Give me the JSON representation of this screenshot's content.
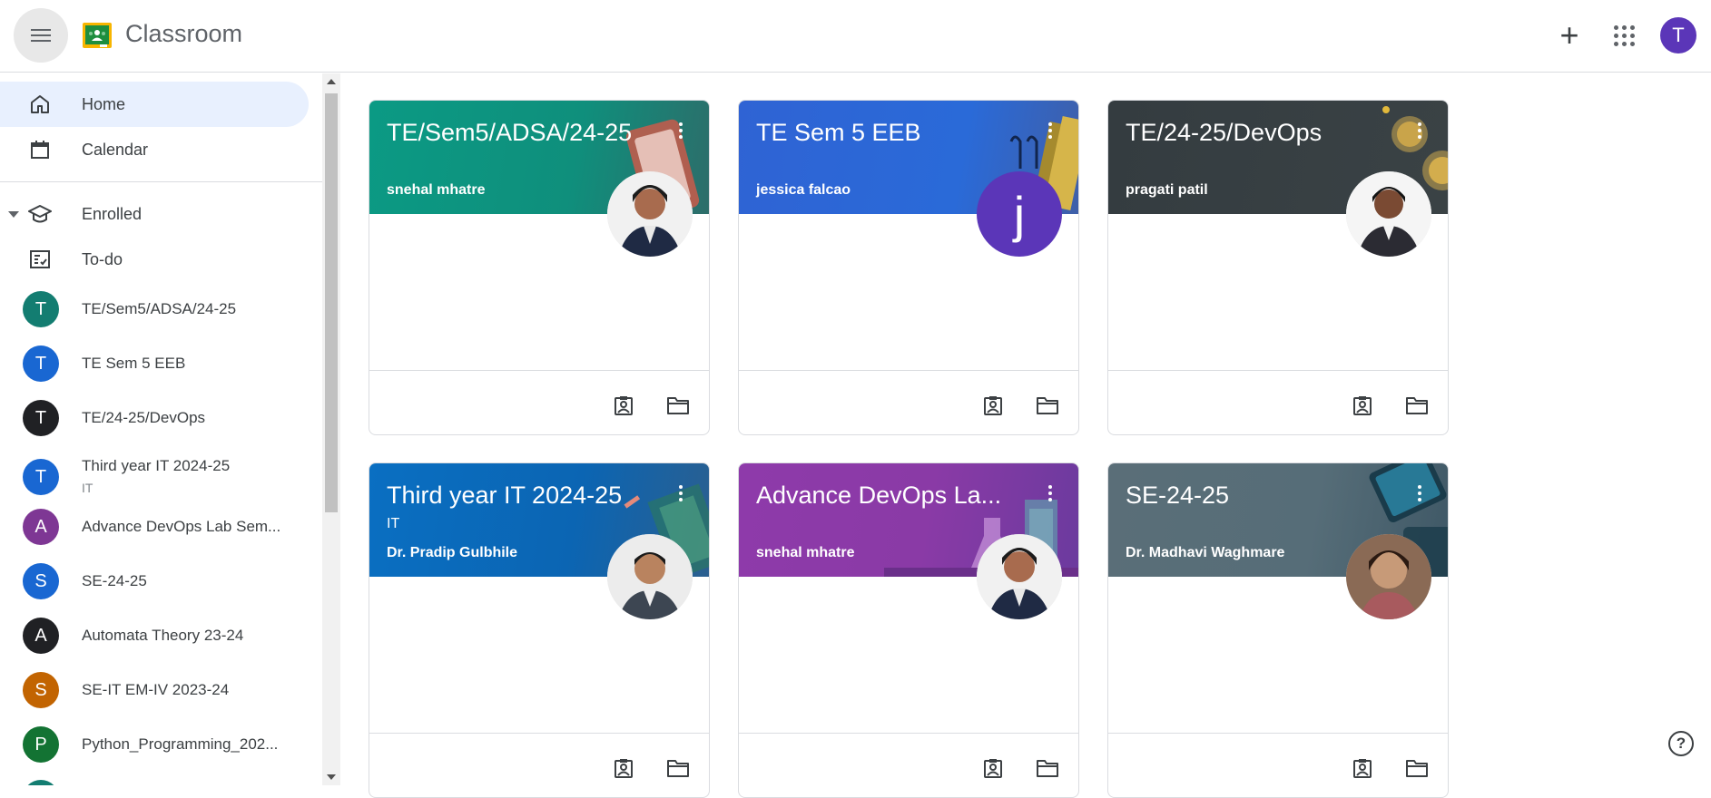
{
  "app": {
    "title": "Classroom",
    "user_initial": "T",
    "accent": "#5b36b8"
  },
  "sidebar": {
    "home": "Home",
    "calendar": "Calendar",
    "enrolled": "Enrolled",
    "todo": "To-do",
    "classes": [
      {
        "initial": "T",
        "name": "TE/Sem5/ADSA/24-25",
        "color": "#137d71"
      },
      {
        "initial": "T",
        "name": "TE Sem 5 EEB",
        "color": "#1967d2"
      },
      {
        "initial": "T",
        "name": "TE/24-25/DevOps",
        "color": "#202124"
      },
      {
        "initial": "T",
        "name": "Third year IT 2024-25",
        "sub": "IT",
        "color": "#1967d2"
      },
      {
        "initial": "A",
        "name": "Advance DevOps Lab Sem...",
        "color": "#7e3794"
      },
      {
        "initial": "S",
        "name": "SE-24-25",
        "color": "#1967d2"
      },
      {
        "initial": "A",
        "name": "Automata Theory 23-24",
        "color": "#202124"
      },
      {
        "initial": "S",
        "name": "SE-IT EM-IV 2023-24",
        "color": "#c26401"
      },
      {
        "initial": "P",
        "name": "Python_Programming_202...",
        "color": "#137333"
      }
    ]
  },
  "cards": [
    {
      "title": "TE/Sem5/ADSA/24-25",
      "section": "",
      "teacher": "snehal mhatre",
      "color": "#0f9d7f"
    },
    {
      "title": "TE Sem 5 EEB",
      "section": "",
      "teacher": "jessica falcao",
      "color": "#2d6bd6",
      "avatar_letter": "j"
    },
    {
      "title": "TE/24-25/DevOps",
      "section": "",
      "teacher": "pragati patil",
      "color": "#3a4245"
    },
    {
      "title": "Third year IT 2024-25",
      "section": "IT",
      "teacher": "Dr. Pradip Gulbhile",
      "color": "#0b6dbe"
    },
    {
      "title": "Advance DevOps La...",
      "section": "",
      "teacher": "snehal mhatre",
      "color": "#8a3aa6"
    },
    {
      "title": "SE-24-25",
      "section": "",
      "teacher": "Dr. Madhavi Waghmare",
      "color": "#566d78"
    }
  ]
}
